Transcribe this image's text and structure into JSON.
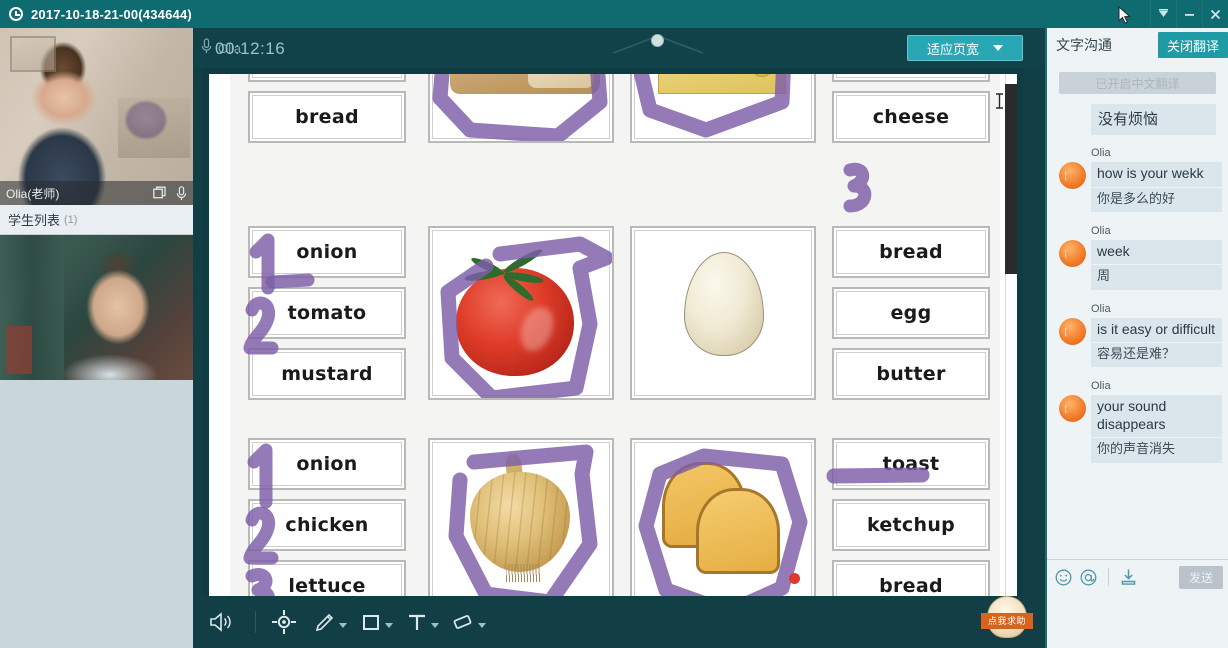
{
  "window": {
    "title": "2017-10-18-21-00(434644)",
    "clock_icon": "clock-icon",
    "controls": [
      {
        "name": "chevron-down-icon",
        "label": "▼"
      },
      {
        "name": "minimize-icon",
        "label": "—"
      },
      {
        "name": "close-icon",
        "label": "✕"
      }
    ]
  },
  "left_panel": {
    "teacher": {
      "name": "Olia(老师)",
      "window_icon": "restore-window-icon",
      "mic_icon": "microphone-icon"
    },
    "student_list": {
      "title": "学生列表",
      "count": "(1)"
    }
  },
  "center": {
    "mic_label": "Olia",
    "mic_icon": "microphone-icon",
    "timer": "00:12:16",
    "fit_button": {
      "label": "适应页宽",
      "caret_icon": "caret-down-icon"
    },
    "toolbar": [
      {
        "name": "speaker-tool",
        "icon": "speaker-icon",
        "has_caret": false
      },
      {
        "name": "pointer-tool",
        "icon": "target-pointer-icon",
        "has_caret": false
      },
      {
        "name": "pen-tool",
        "icon": "pencil-icon",
        "has_caret": true
      },
      {
        "name": "shape-tool",
        "icon": "square-icon",
        "has_caret": true
      },
      {
        "name": "text-tool",
        "icon": "text-T-icon",
        "has_caret": true
      },
      {
        "name": "eraser-tool",
        "icon": "eraser-icon",
        "has_caret": true
      }
    ],
    "mascot": {
      "label": "点我求助"
    }
  },
  "worksheet": {
    "rows": [
      {
        "left_words": [
          "bread"
        ],
        "left_picture": "bread-slices",
        "right_picture": "cheese-block",
        "right_words": [
          "cheese"
        ]
      },
      {
        "left_words": [
          "onion",
          "tomato",
          "mustard"
        ],
        "left_picture": "tomato",
        "right_picture": "egg",
        "right_words": [
          "bread",
          "egg",
          "butter"
        ]
      },
      {
        "left_words": [
          "onion",
          "chicken",
          "lettuce"
        ],
        "left_picture": "onion",
        "right_picture": "toast-slices",
        "right_words": [
          "toast",
          "ketchup",
          "bread"
        ]
      }
    ],
    "annotation_color": "#7d5ea8",
    "marker_dot_color": "#e03a2f"
  },
  "chat": {
    "title": "文字沟通",
    "close_translate_label": "关闭翻译",
    "system_notice": "已开启中文翻译",
    "standalone_message": "没有烦恼",
    "messages": [
      {
        "sender": "Olia",
        "en": "how is your wekk",
        "zh": "你是多么的好"
      },
      {
        "sender": "Olia",
        "en": "week",
        "zh": "周"
      },
      {
        "sender": "Olia",
        "en": "is it easy or difficult",
        "zh": "容易还是难？"
      },
      {
        "sender": "Olia",
        "en": "your sound disappears",
        "zh": "你的声音消失"
      }
    ],
    "tools": [
      {
        "name": "emoji-icon"
      },
      {
        "name": "at-mention-icon"
      },
      {
        "name": "download-icon"
      }
    ],
    "send_label": "发送"
  }
}
